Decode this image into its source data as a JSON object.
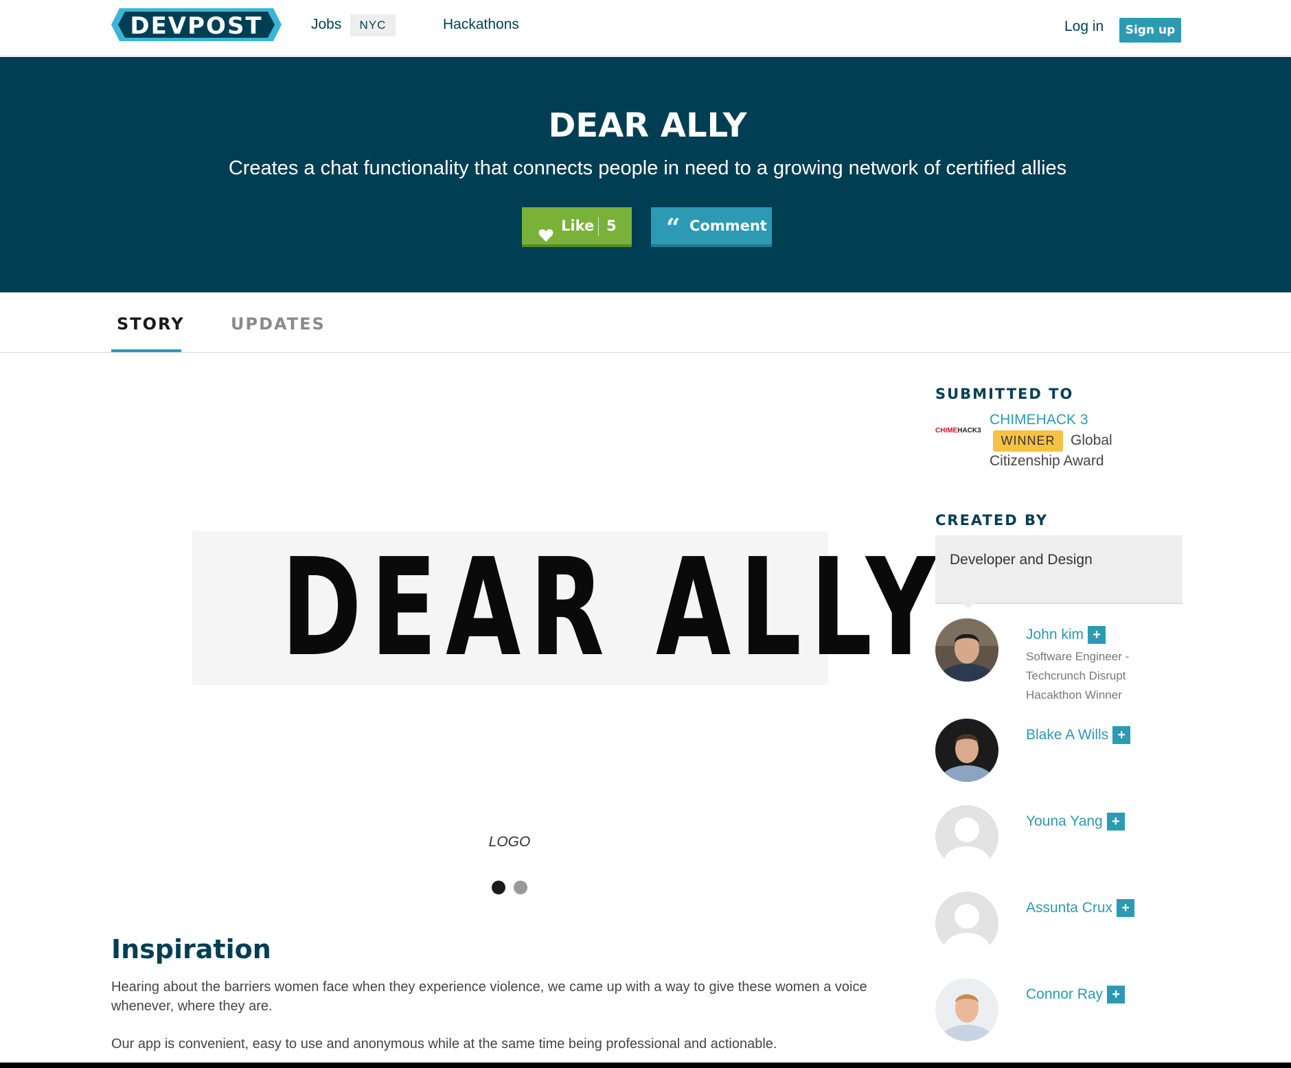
{
  "nav": {
    "logo_text": "DEVPOST",
    "jobs_label": "Jobs",
    "jobs_location": "NYC",
    "hackathons_label": "Hackathons",
    "login_label": "Log in",
    "signup_label": "Sign up"
  },
  "hero": {
    "title": "DEAR ALLY",
    "tagline": "Creates a chat functionality that connects people in need to a growing network of certified allies",
    "like_label": "Like",
    "like_count": "5",
    "comment_label": "Comment"
  },
  "tabs": [
    {
      "label": "STORY",
      "active": true
    },
    {
      "label": "UPDATES",
      "active": false
    }
  ],
  "gallery": {
    "image_text": "DEAR ALLY",
    "caption": "LOGO",
    "slide_count": 2,
    "current_slide": 1
  },
  "story": {
    "heading": "Inspiration",
    "paragraphs": [
      "Hearing about the barriers women face when they experience violence, we came up with a way to give these women a voice whenever, where they are.",
      "Our app is convenient, easy to use and anonymous while at the same time being professional and actionable."
    ]
  },
  "sidebar": {
    "submitted_heading": "SUBMITTED TO",
    "hackathon_logo_red": "CHIME",
    "hackathon_logo_black": "HACK3",
    "hackathon_name": "CHIMEHACK 3",
    "winner_badge": "WINNER",
    "award_line1": "Global",
    "award_line2": "Citizenship Award",
    "created_heading": "CREATED BY",
    "role_text": "Developer and Design",
    "members": [
      {
        "name": "John kim",
        "bio": "Software Engineer - Techcrunch Disrupt Hacakthon Winner",
        "avatar": "photo"
      },
      {
        "name": "Blake A Wills",
        "bio": "",
        "avatar": "photo"
      },
      {
        "name": "Youna Yang",
        "bio": "",
        "avatar": "default-user-icon"
      },
      {
        "name": "Assunta Crux",
        "bio": "",
        "avatar": "default-user-icon"
      },
      {
        "name": "Connor Ray",
        "bio": "",
        "avatar": "photo"
      }
    ],
    "follow_symbol": "+"
  },
  "colors": {
    "brand_dark": "#003e54",
    "accent_teal": "#2b9ab2",
    "like_green": "#7ab139",
    "winner_yellow": "#f5c244"
  }
}
